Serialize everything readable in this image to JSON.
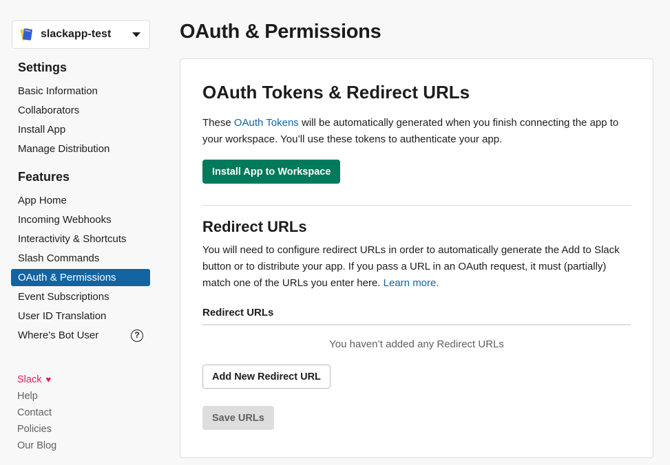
{
  "app_picker": {
    "name": "slackapp-test"
  },
  "sidebar": {
    "settings_heading": "Settings",
    "settings_items": [
      {
        "label": "Basic Information"
      },
      {
        "label": "Collaborators"
      },
      {
        "label": "Install App"
      },
      {
        "label": "Manage Distribution"
      }
    ],
    "features_heading": "Features",
    "features_items": [
      {
        "label": "App Home"
      },
      {
        "label": "Incoming Webhooks"
      },
      {
        "label": "Interactivity & Shortcuts"
      },
      {
        "label": "Slash Commands"
      },
      {
        "label": "OAuth & Permissions",
        "active": true
      },
      {
        "label": "Event Subscriptions"
      },
      {
        "label": "User ID Translation"
      },
      {
        "label": "Where’s Bot User",
        "help_icon": "question-circle-icon"
      }
    ],
    "help_glyph": "?",
    "footer": {
      "slack": "Slack",
      "heart": "♥",
      "help": "Help",
      "contact": "Contact",
      "policies": "Policies",
      "blog": "Our Blog"
    }
  },
  "main": {
    "page_title": "OAuth & Permissions",
    "tokens": {
      "title": "OAuth Tokens & Redirect URLs",
      "text_before": "These ",
      "link": "OAuth Tokens",
      "text_after": " will be automatically generated when you finish connecting the app to your workspace. You’ll use these tokens to authenticate your app.",
      "install_button": "Install App to Workspace"
    },
    "redirect": {
      "title": "Redirect URLs",
      "text": "You will need to configure redirect URLs in order to automatically generate the Add to Slack button or to distribute your app. If you pass a URL in an OAuth request, it must (partially) match one of the URLs you enter here. ",
      "learn_more": "Learn more.",
      "table_header": "Redirect URLs",
      "empty_message": "You haven’t added any Redirect URLs",
      "add_button": "Add New Redirect URL",
      "save_button": "Save URLs"
    }
  },
  "colors": {
    "accent_blue": "#1264a3",
    "primary_green": "#007a5a",
    "slack_pink": "#e01e5a"
  }
}
